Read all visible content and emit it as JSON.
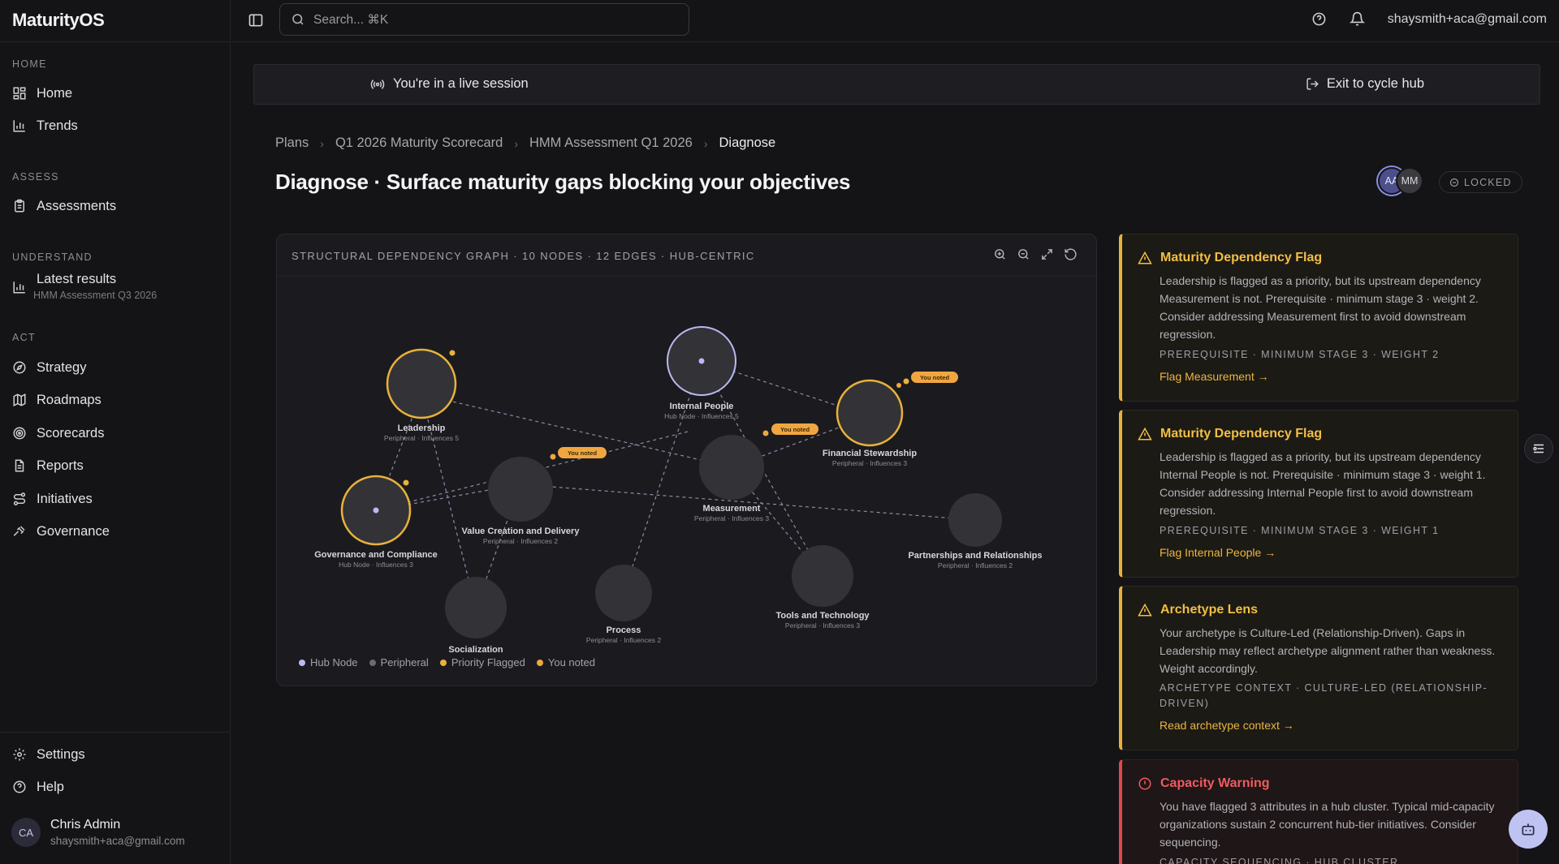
{
  "app": {
    "name": "MaturityOS"
  },
  "sidebar": {
    "sections": [
      {
        "label": "HOME",
        "items": [
          {
            "label": "Home",
            "icon": "grid-icon"
          },
          {
            "label": "Trends",
            "icon": "bar-chart-icon"
          }
        ]
      },
      {
        "label": "ASSESS",
        "items": [
          {
            "label": "Assessments",
            "icon": "clipboard-icon"
          }
        ]
      },
      {
        "label": "UNDERSTAND",
        "items": [
          {
            "label": "Latest results",
            "sub": "HMM Assessment Q3 2026",
            "icon": "bar-chart-icon"
          }
        ]
      },
      {
        "label": "ACT",
        "items": [
          {
            "label": "Strategy",
            "icon": "compass-icon"
          },
          {
            "label": "Roadmaps",
            "icon": "map-icon"
          },
          {
            "label": "Scorecards",
            "icon": "target-icon"
          },
          {
            "label": "Reports",
            "icon": "file-text-icon"
          },
          {
            "label": "Initiatives",
            "icon": "route-icon"
          },
          {
            "label": "Governance",
            "icon": "gavel-icon"
          }
        ]
      }
    ],
    "bottom": [
      {
        "label": "Settings",
        "icon": "gear-icon"
      },
      {
        "label": "Help",
        "icon": "help-circle-icon"
      }
    ],
    "profile": {
      "initials": "CA",
      "name": "Chris Admin",
      "email": "shaysmith+aca@gmail.com"
    }
  },
  "topbar": {
    "search_placeholder": "Search... ⌘K",
    "user_email": "shaysmith+aca@gmail.com"
  },
  "banner": {
    "text": "You're in a live session",
    "exit_label": "Exit to cycle hub"
  },
  "breadcrumb": [
    "Plans",
    "Q1 2026 Maturity Scorecard",
    "HMM Assessment Q1 2026",
    "Diagnose"
  ],
  "page": {
    "title": "Diagnose · Surface maturity gaps blocking your objectives"
  },
  "presence": {
    "users": [
      "AA",
      "MM"
    ],
    "lock_label": "LOCKED"
  },
  "graph": {
    "header": "STRUCTURAL DEPENDENCY GRAPH · 10 NODES · 12 EDGES · HUB-CENTRIC",
    "nodes": [
      {
        "id": "leadership",
        "label": "Leadership",
        "sub": "Peripheral · Influences 5",
        "kind": "priority"
      },
      {
        "id": "internal_people",
        "label": "Internal People",
        "sub": "Hub Node · Influences 5",
        "kind": "hub"
      },
      {
        "id": "financial",
        "label": "Financial Stewardship",
        "sub": "Peripheral · Influences 3",
        "kind": "priority",
        "badge": "You noted"
      },
      {
        "id": "governance",
        "label": "Governance and Compliance",
        "sub": "Hub Node · Influences 3",
        "kind": "priority"
      },
      {
        "id": "value",
        "label": "Value Creation and Delivery",
        "sub": "Peripheral · Influences 2",
        "kind": "peripheral",
        "badge": "You noted"
      },
      {
        "id": "measurement",
        "label": "Measurement",
        "sub": "Peripheral · Influences 3",
        "kind": "peripheral",
        "badge": "You noted"
      },
      {
        "id": "partnerships",
        "label": "Partnerships and Relationships",
        "sub": "Peripheral · Influences 2",
        "kind": "peripheral"
      },
      {
        "id": "tools",
        "label": "Tools and Technology",
        "sub": "Peripheral · Influences 3",
        "kind": "peripheral"
      },
      {
        "id": "process",
        "label": "Process",
        "sub": "Peripheral · Influences 2",
        "kind": "peripheral"
      },
      {
        "id": "socialization",
        "label": "Socialization",
        "sub": "",
        "kind": "peripheral"
      }
    ],
    "legend": [
      {
        "label": "Hub Node",
        "color": "#b9b9f2"
      },
      {
        "label": "Peripheral",
        "color": "#6b6b70"
      },
      {
        "label": "Priority Flagged",
        "color": "#e8b23a"
      },
      {
        "label": "You noted",
        "color": "#f0a640"
      }
    ]
  },
  "flags": [
    {
      "title": "Maturity Dependency Flag",
      "body": "Leadership is flagged as a priority, but its upstream dependency Measurement is not. Prerequisite · minimum stage 3 · weight 2. Consider addressing Measurement first to avoid downstream regression.",
      "meta": "PREREQUISITE · MINIMUM STAGE 3 · WEIGHT 2",
      "link": "Flag Measurement →"
    },
    {
      "title": "Maturity Dependency Flag",
      "body": "Leadership is flagged as a priority, but its upstream dependency Internal People is not. Prerequisite · minimum stage 3 · weight 1. Consider addressing Internal People first to avoid downstream regression.",
      "meta": "PREREQUISITE · MINIMUM STAGE 3 · WEIGHT 1",
      "link": "Flag Internal People →"
    },
    {
      "title": "Archetype Lens",
      "body": "Your archetype is Culture-Led (Relationship-Driven). Gaps in Leadership may reflect archetype alignment rather than weakness. Weight accordingly.",
      "meta": "ARCHETYPE CONTEXT · CULTURE-LED (RELATIONSHIP-DRIVEN)",
      "link": "Read archetype context →"
    },
    {
      "title": "Capacity Warning",
      "body": "You have flagged 3 attributes in a hub cluster. Typical mid-capacity organizations sustain 2 concurrent hub-tier initiatives. Consider sequencing.",
      "meta": "CAPACITY SEQUENCING · HUB CLUSTER"
    }
  ]
}
